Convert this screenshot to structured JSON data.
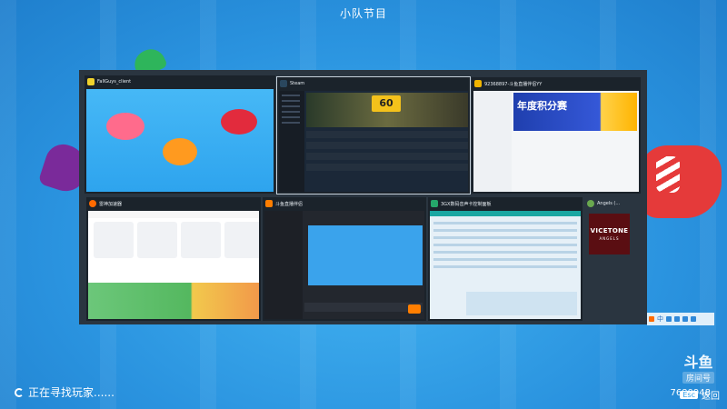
{
  "screen": {
    "title": "小队节目",
    "status_text": "正在寻找玩家......"
  },
  "switcher": {
    "tiles": [
      {
        "title": "FallGuys_client",
        "icon_color": "#f0d22c"
      },
      {
        "title": "Steam",
        "icon_color": "#1b2838"
      },
      {
        "title": "92368897-斗鱼直播伴侣YY",
        "icon_color": "#f0b400"
      },
      {
        "title": "雷神加速器",
        "icon_color": "#ff6a00"
      },
      {
        "title": "斗鱼直播伴侣",
        "icon_color": "#ff7e00"
      },
      {
        "title": "3GX数码音声卡控制面板",
        "icon_color": "#25a66a"
      },
      {
        "title": "Angels (...",
        "icon_color": "#5a0e12"
      }
    ],
    "steam_banner_text": "60",
    "qq_banner_text": "年度积分赛",
    "angels_cover": {
      "line1": "VICETONE",
      "line2": "ANGELS"
    }
  },
  "tray": {
    "ime": "中"
  },
  "watermark": {
    "logo": "斗鱼",
    "badge": "房间号",
    "room": "7680948"
  },
  "back": {
    "key": "Esc",
    "label": "返回"
  }
}
